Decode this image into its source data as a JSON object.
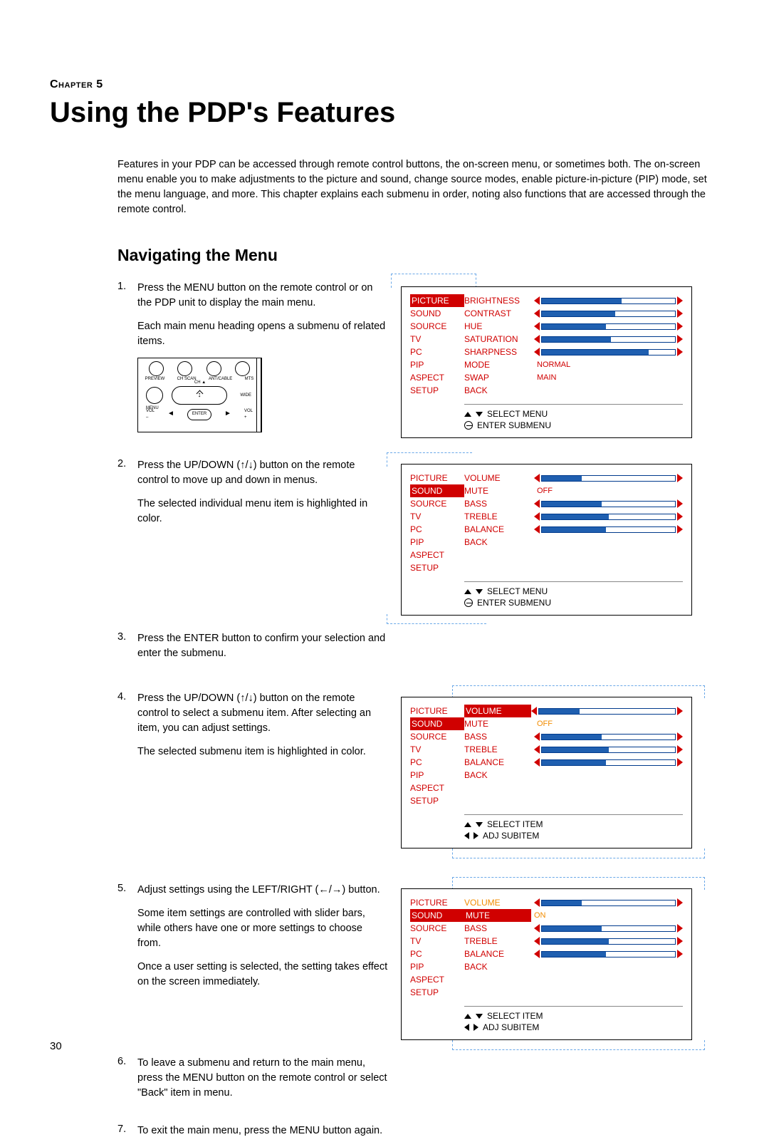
{
  "chapter": "Chapter 5",
  "title": "Using the PDP's Features",
  "intro": "Features in your PDP can be accessed through remote control buttons, the on-screen menu, or sometimes both. The on-screen menu enable you to make adjustments to the picture and sound, change source modes, enable picture-in-picture (PIP) mode, set the menu language, and more. This chapter explains each submenu in order, noting also functions that are accessed through the remote control.",
  "section": "Navigating the Menu",
  "steps": {
    "s1": {
      "num": "1.",
      "p1": "Press the MENU button on the remote control or on the PDP unit to display the main menu.",
      "p2": "Each main menu heading opens a submenu of related items."
    },
    "s2": {
      "num": "2.",
      "p1": "Press the UP/DOWN (↑/↓) button on the remote control to move up and down in menus.",
      "p2": "The selected individual menu item is highlighted in color."
    },
    "s3": {
      "num": "3.",
      "p1": "Press the ENTER button to confirm your selection and enter the submenu."
    },
    "s4": {
      "num": "4.",
      "p1": "Press the UP/DOWN (↑/↓) button on the remote control to select a submenu item. After selecting an item, you can adjust settings.",
      "p2": "The selected submenu item is highlighted in color."
    },
    "s5": {
      "num": "5.",
      "p1": "Adjust settings using the LEFT/RIGHT (←/→) button.",
      "p2": "Some item settings are controlled with slider bars, while others have one or more settings to choose from.",
      "p3": "Once a user setting is selected, the setting takes effect on the screen immediately."
    },
    "s6": {
      "num": "6.",
      "p1": "To leave a submenu and return to the main menu, press the MENU button on the remote control or select \"Back\" item in menu."
    },
    "s7": {
      "num": "7.",
      "p1": "To exit the main menu, press the MENU button again."
    }
  },
  "remote": {
    "r1": [
      "PREVIEW",
      "CH SCAN",
      "ANT/CABLE",
      "MTS"
    ],
    "ch": "CH ▲",
    "menu": "MENU",
    "wide": "WIDE",
    "volm": "VOL\n–",
    "volp": "VOL\n+",
    "enter": "ENTER"
  },
  "osd_menu_items": [
    "PICTURE",
    "SOUND",
    "SOURCE",
    "TV",
    "PC",
    "PIP",
    "ASPECT",
    "SETUP"
  ],
  "osd1": {
    "sub": [
      {
        "label": "BRIGHTNESS",
        "ctrl": "slider",
        "fill": 60
      },
      {
        "label": "CONTRAST",
        "ctrl": "slider",
        "fill": 55
      },
      {
        "label": "HUE",
        "ctrl": "slider",
        "fill": 48
      },
      {
        "label": "SATURATION",
        "ctrl": "slider",
        "fill": 52
      },
      {
        "label": "SHARPNESS",
        "ctrl": "slider",
        "fill": 80
      },
      {
        "label": "MODE",
        "ctrl": "text",
        "val": "NORMAL"
      },
      {
        "label": "SWAP",
        "ctrl": "text",
        "val": "MAIN"
      },
      {
        "label": "BACK",
        "ctrl": "none"
      }
    ],
    "hint1": "SELECT MENU",
    "hint2": "ENTER SUBMENU"
  },
  "osd2": {
    "sub": [
      {
        "label": "VOLUME",
        "ctrl": "slider",
        "fill": 30
      },
      {
        "label": "MUTE",
        "ctrl": "text",
        "val": "OFF"
      },
      {
        "label": "BASS",
        "ctrl": "slider",
        "fill": 45
      },
      {
        "label": "TREBLE",
        "ctrl": "slider",
        "fill": 50
      },
      {
        "label": "BALANCE",
        "ctrl": "slider",
        "fill": 48
      },
      {
        "label": "BACK",
        "ctrl": "none"
      }
    ],
    "hint1": "SELECT MENU",
    "hint2": "ENTER SUBMENU"
  },
  "osd3": {
    "sub": [
      {
        "label": "VOLUME",
        "ctrl": "slider",
        "fill": 30,
        "hl": true
      },
      {
        "label": "MUTE",
        "ctrl": "textorange",
        "val": "OFF"
      },
      {
        "label": "BASS",
        "ctrl": "slider",
        "fill": 45
      },
      {
        "label": "TREBLE",
        "ctrl": "slider",
        "fill": 50
      },
      {
        "label": "BALANCE",
        "ctrl": "slider",
        "fill": 48
      },
      {
        "label": "BACK",
        "ctrl": "none"
      }
    ],
    "hint1": "SELECT ITEM",
    "hint2": "ADJ SUBITEM"
  },
  "osd4": {
    "sub": [
      {
        "label": "VOLUME",
        "ctrl": "slider",
        "fill": 30,
        "subOrange": true
      },
      {
        "label": "MUTE",
        "ctrl": "textorange",
        "val": "ON",
        "hl": true
      },
      {
        "label": "BASS",
        "ctrl": "slider",
        "fill": 45
      },
      {
        "label": "TREBLE",
        "ctrl": "slider",
        "fill": 50
      },
      {
        "label": "BALANCE",
        "ctrl": "slider",
        "fill": 48
      },
      {
        "label": "BACK",
        "ctrl": "none"
      }
    ],
    "hint1": "SELECT ITEM",
    "hint2": "ADJ SUBITEM"
  },
  "page": "30"
}
